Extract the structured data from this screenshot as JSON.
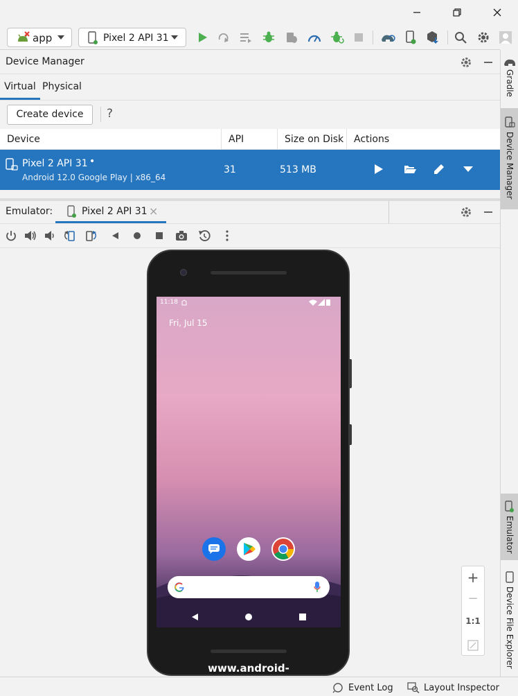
{
  "toolbar": {
    "run_config": "app",
    "device_selector": "Pixel 2 API 31"
  },
  "device_manager": {
    "title": "Device Manager",
    "tabs": [
      {
        "label": "Virtual"
      },
      {
        "label": "Physical"
      }
    ],
    "create_device_label": "Create device",
    "help_label": "?",
    "columns": {
      "device": "Device",
      "api": "API",
      "size": "Size on Disk",
      "actions": "Actions"
    },
    "rows": [
      {
        "name": "Pixel 2 API 31",
        "online_dot": "•",
        "description": "Android 12.0 Google Play | x86_64",
        "api": "31",
        "size": "513 MB"
      }
    ]
  },
  "emulator": {
    "label": "Emulator:",
    "tab_label": "Pixel 2 API 31",
    "close_glyph": "×",
    "screen": {
      "time": "11:18",
      "date": "Fri, Jul 15"
    },
    "zoom": {
      "plus": "+",
      "minus": "−",
      "actual": "1:1"
    },
    "watermark": "www.android-studio.ir"
  },
  "side_tabs": {
    "gradle": "Gradle",
    "device_manager": "Device Manager",
    "emulator": "Emulator",
    "device_file_explorer": "Device File Explorer"
  },
  "status_bar": {
    "event_log": "Event Log",
    "layout_inspector": "Layout Inspector"
  },
  "colors": {
    "accent": "#2675bf",
    "run_green": "#4caf50",
    "online_green": "#43a047"
  }
}
